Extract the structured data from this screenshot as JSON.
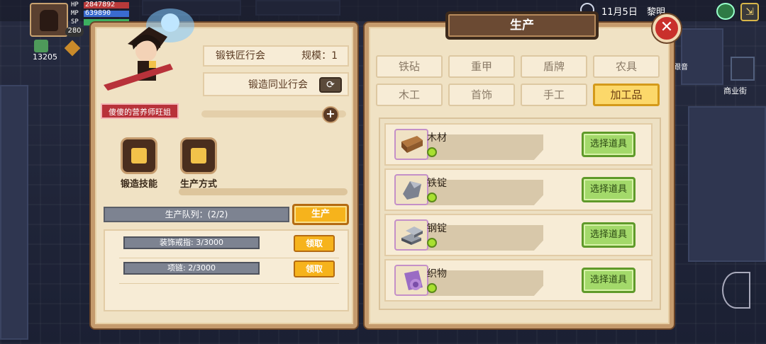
{
  "hud": {
    "hp_value": "2847892",
    "mp_value": "639890",
    "sp_value": "",
    "hp_tag": "HP",
    "mp_tag": "MP",
    "sp_tag": "SP",
    "level": "280",
    "gold": "13205",
    "date": "11月5日",
    "time_of_day": "黎明",
    "street_label": "商业街",
    "side_label": "跟音"
  },
  "left_panel": {
    "guild_name": "锻铁匠行会",
    "scale_label": "规模：1",
    "union_label": "锻造同业行会",
    "hero_name": "傻傻的营养师旺姐",
    "skills": [
      {
        "label": "锻造技能",
        "icon": "anvil-icon"
      },
      {
        "label": "生产方式",
        "icon": "robot-arm-icon"
      }
    ],
    "queue_label": "生产队列：(2/2)",
    "produce_label": "生产",
    "queue_items": [
      {
        "label": "装饰戒指: 3/3000",
        "claim": "领取"
      },
      {
        "label": "项链: 2/3000",
        "claim": "领取"
      }
    ]
  },
  "right_panel": {
    "title": "生产",
    "close_symbol": "✕",
    "tabs": [
      {
        "label": "铁砧",
        "active": false
      },
      {
        "label": "重甲",
        "active": false
      },
      {
        "label": "盾牌",
        "active": false
      },
      {
        "label": "农具",
        "active": false
      },
      {
        "label": "木工",
        "active": false
      },
      {
        "label": "首饰",
        "active": false
      },
      {
        "label": "手工",
        "active": false
      },
      {
        "label": "加工品",
        "active": true
      }
    ],
    "materials": [
      {
        "name": "木材",
        "icon": "wood-plank-icon",
        "button": "选择道具"
      },
      {
        "name": "铁锭",
        "icon": "iron-ore-icon",
        "button": "选择道具"
      },
      {
        "name": "钢锭",
        "icon": "steel-ingot-icon",
        "button": "选择道具"
      },
      {
        "name": "织物",
        "icon": "fabric-roll-icon",
        "button": "选择道具"
      }
    ]
  },
  "colors": {
    "panel_bg": "#f0e2c4",
    "panel_border": "#c59b6d",
    "gold_button": "#f6b31c",
    "green_button": "#a3d96a",
    "close_red": "#c9302c",
    "active_tab": "#fcd86a"
  }
}
